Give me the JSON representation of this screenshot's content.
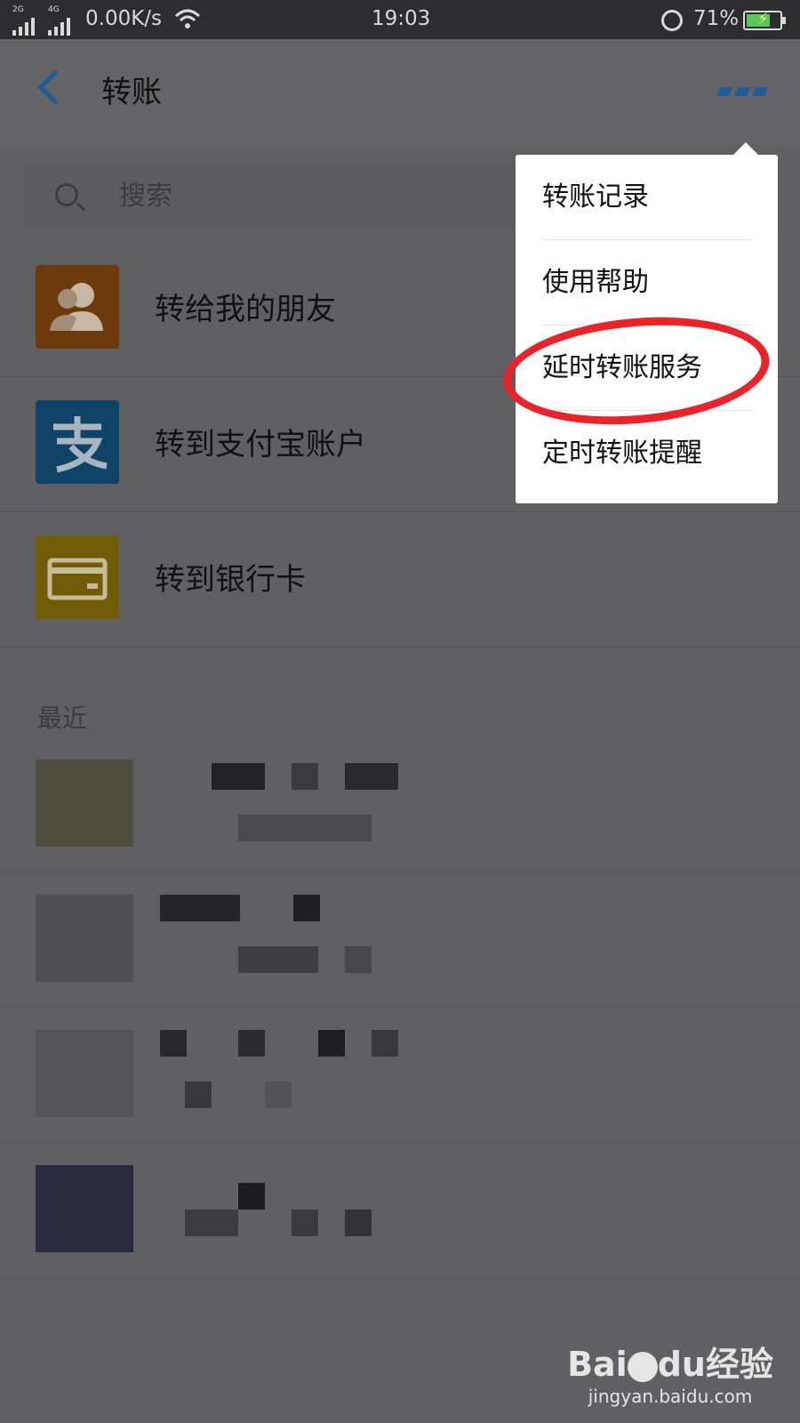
{
  "status_bar": {
    "net1": "2G",
    "net2": "4G",
    "speed": "0.00K/s",
    "time": "19:03",
    "battery": "71%",
    "battery_level": 0.71
  },
  "header": {
    "title": "转账",
    "back_icon": "back-arrow-icon",
    "more_icon": "more-dots-icon"
  },
  "search": {
    "placeholder": "搜索"
  },
  "options": [
    {
      "label": "转给我的朋友",
      "icon": "friends-icon",
      "color": "#6d3a0c"
    },
    {
      "label": "转到支付宝账户",
      "icon": "alipay-icon",
      "color": "#0f4468"
    },
    {
      "label": "转到银行卡",
      "icon": "bank-card-icon",
      "color": "#6f5b08"
    }
  ],
  "recent": {
    "label": "最近"
  },
  "menu": {
    "items": [
      {
        "label": "转账记录"
      },
      {
        "label": "使用帮助"
      },
      {
        "label": "延时转账服务"
      },
      {
        "label": "定时转账提醒"
      }
    ],
    "highlight_color": "#e8232a"
  },
  "watermark": {
    "brand": "Bai",
    "brand2": "du",
    "brand_cn": "经验",
    "url": "jingyan.baidu.com"
  }
}
